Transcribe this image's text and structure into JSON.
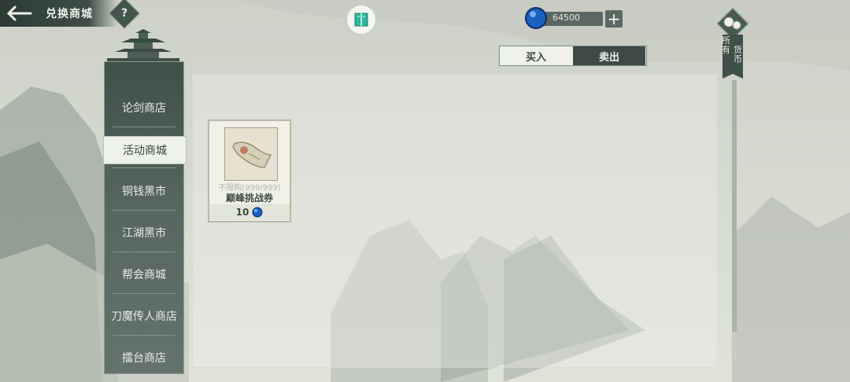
{
  "header": {
    "back_icon": "arrow-left-icon",
    "title": "兑换商城",
    "help_label": "?"
  },
  "currency": {
    "icon": "blue-orb-icon",
    "amount": "64500",
    "add_label": "+"
  },
  "tabs": {
    "buy": "买入",
    "sell": "卖出",
    "active": "sell"
  },
  "sidebar": {
    "items": [
      {
        "label": "论剑商店"
      },
      {
        "label": "活动商城"
      },
      {
        "label": "铜钱黑市"
      },
      {
        "label": "江湖黑市"
      },
      {
        "label": "帮会商城"
      },
      {
        "label": "刀魔传人商店"
      },
      {
        "label": "擂台商店"
      }
    ],
    "active_index": 1
  },
  "item": {
    "name": "巅峰挑战券",
    "limit": "不限购(999/999)",
    "price": "10",
    "price_icon": "blue-orb-icon"
  },
  "right_tab": {
    "col1": "所有",
    "col2": "货币"
  },
  "colors": {
    "panel_dark": "#3d4a45",
    "bg_mist": "#d7d9d0",
    "accent_blue": "#1f6fd1"
  }
}
